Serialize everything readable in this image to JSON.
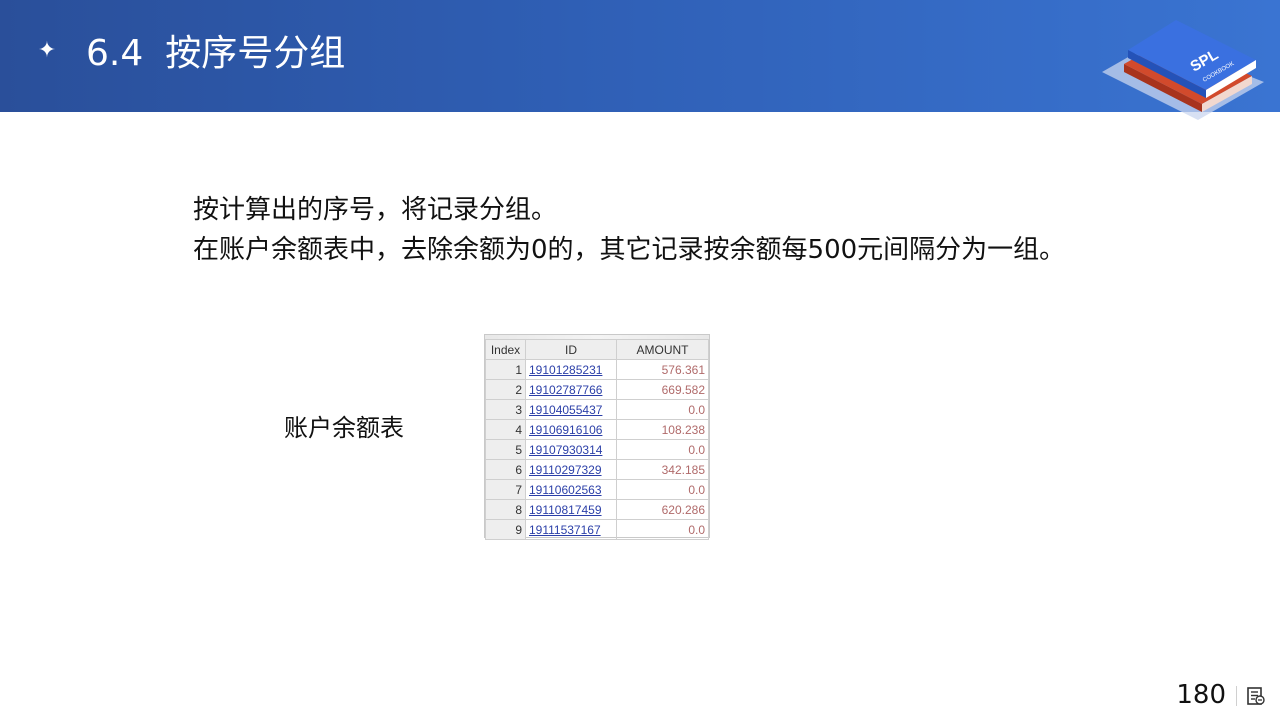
{
  "header": {
    "bullet_icon": "four-point-star-icon",
    "section_number": "6.4",
    "section_title": "按序号分组",
    "logo": {
      "text_main": "SPL",
      "text_sub": "COOKBOOK",
      "icon": "stacked-books-logo"
    }
  },
  "description": {
    "line1": "按计算出的序号，将记录分组。",
    "line2": "在账户余额表中，去除余额为0的，其它记录按余额每500元间隔分为一组。"
  },
  "table_label": "账户余额表",
  "table": {
    "columns": [
      "Index",
      "ID",
      "AMOUNT"
    ],
    "rows": [
      [
        "1",
        "19101285231",
        "576.361"
      ],
      [
        "2",
        "19102787766",
        "669.582"
      ],
      [
        "3",
        "19104055437",
        "0.0"
      ],
      [
        "4",
        "19106916106",
        "108.238"
      ],
      [
        "5",
        "19107930314",
        "0.0"
      ],
      [
        "6",
        "19110297329",
        "342.185"
      ],
      [
        "7",
        "19110602563",
        "0.0"
      ],
      [
        "8",
        "19110817459",
        "620.286"
      ],
      [
        "9",
        "19111537167",
        "0.0"
      ]
    ]
  },
  "footer": {
    "page_number": "180",
    "page_icon": "slide-notes-icon"
  },
  "colors": {
    "header_start": "#2a4f9a",
    "header_end": "#3a74d2",
    "id_link": "#2b3fa8",
    "amount_text": "#b06a6a"
  }
}
